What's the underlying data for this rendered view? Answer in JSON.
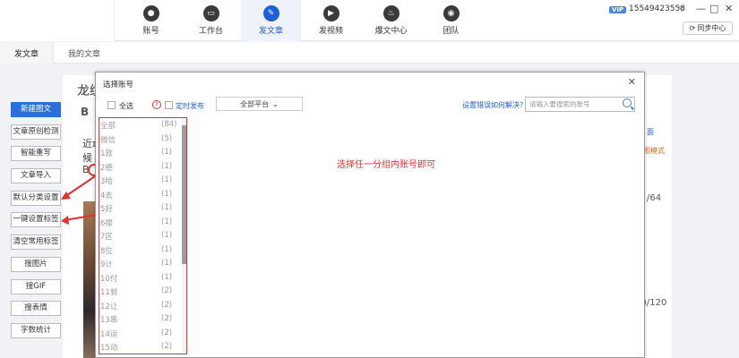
{
  "nav": {
    "items": [
      {
        "label": "账号",
        "icon": "person-icon"
      },
      {
        "label": "工作台",
        "icon": "monitor-icon"
      },
      {
        "label": "发文章",
        "icon": "pen-icon",
        "active": true
      },
      {
        "label": "发视频",
        "icon": "play-icon"
      },
      {
        "label": "爆文中心",
        "icon": "flame-icon"
      },
      {
        "label": "团队",
        "icon": "team-icon"
      }
    ]
  },
  "account": {
    "vip": "VIP",
    "phone": "15549423558",
    "switch_label": "同步中心"
  },
  "window_controls": {
    "menu": "▽",
    "minimize": "—",
    "maximize": "□",
    "close": "✕"
  },
  "subtabs": [
    {
      "label": "发文章",
      "active": true
    },
    {
      "label": "我的文章"
    }
  ],
  "left_tools": [
    "新建图文",
    "文章原创检测",
    "智能重写",
    "文章导入",
    "默认分类设置",
    "一键设置标签",
    "清空常用标签",
    "搜图片",
    "搜GIF",
    "搜表情",
    "字数统计"
  ],
  "editor_peek": {
    "title": "龙纹",
    "bold": "B",
    "line1": "近ɪ",
    "line2": "候",
    "line3": "B",
    "right_a": "面",
    "right_b": "图模式",
    "right_c": "/64",
    "right_d": ")/120"
  },
  "modal": {
    "title": "选择账号",
    "close": "✕",
    "select_all": "全选",
    "scheduled": "定时发布",
    "platform": "全部平台",
    "help_link": "设置错误如何解决？",
    "search_placeholder": "请输入要搜索的账号"
  },
  "groups": [
    {
      "name": "全部",
      "count": "(84)"
    },
    {
      "name": "微信",
      "count": "(5)"
    },
    {
      "name": "1款",
      "count": "(1)"
    },
    {
      "name": "2德",
      "count": "(1)"
    },
    {
      "name": "3哈",
      "count": "(1)"
    },
    {
      "name": "4去",
      "count": "(1)"
    },
    {
      "name": "5好",
      "count": "(1)"
    },
    {
      "name": "6擦",
      "count": "(1)"
    },
    {
      "name": "7区",
      "count": "(1)"
    },
    {
      "name": "8位",
      "count": "(1)"
    },
    {
      "name": "9计",
      "count": "(1)"
    },
    {
      "name": "10付",
      "count": "(1)"
    },
    {
      "name": "11就",
      "count": "(2)"
    },
    {
      "name": "12让",
      "count": "(2)"
    },
    {
      "name": "13串",
      "count": "(2)"
    },
    {
      "name": "14运",
      "count": "(2)"
    },
    {
      "name": "15动",
      "count": "(2)"
    }
  ],
  "annotation": "选择任一分组内账号即可",
  "colors": {
    "accent": "#1e5fd6",
    "annotation": "#dd3333"
  }
}
